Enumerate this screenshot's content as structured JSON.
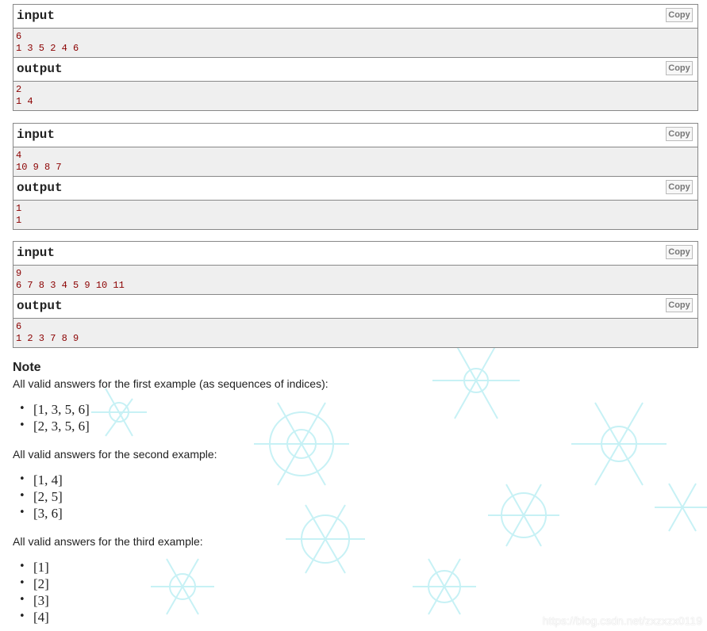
{
  "copy_label": "Copy",
  "samples": [
    {
      "input": {
        "title": "input",
        "lines": [
          "6",
          "1 3 5 2 4 6"
        ]
      },
      "output": {
        "title": "output",
        "lines": [
          "2",
          "1 4"
        ]
      }
    },
    {
      "input": {
        "title": "input",
        "lines": [
          "4",
          "10 9 8 7"
        ]
      },
      "output": {
        "title": "output",
        "lines": [
          "1",
          "1"
        ]
      }
    },
    {
      "input": {
        "title": "input",
        "lines": [
          "9",
          "6 7 8 3 4 5 9 10 11"
        ]
      },
      "output": {
        "title": "output",
        "lines": [
          "6",
          "1 2 3 7 8 9"
        ]
      }
    }
  ],
  "note": {
    "title": "Note",
    "intro1": "All valid answers for the first example (as sequences of indices):",
    "list1": [
      "[1, 3, 5, 6]",
      "[2, 3, 5, 6]"
    ],
    "intro2": "All valid answers for the second example:",
    "list2": [
      "[1, 4]",
      "[2, 5]",
      "[3, 6]"
    ],
    "intro3": "All valid answers for the third example:",
    "list3": [
      "[1]",
      "[2]",
      "[3]",
      "[4]"
    ]
  },
  "watermark": "https://blog.csdn.net/zxzxzx0119"
}
